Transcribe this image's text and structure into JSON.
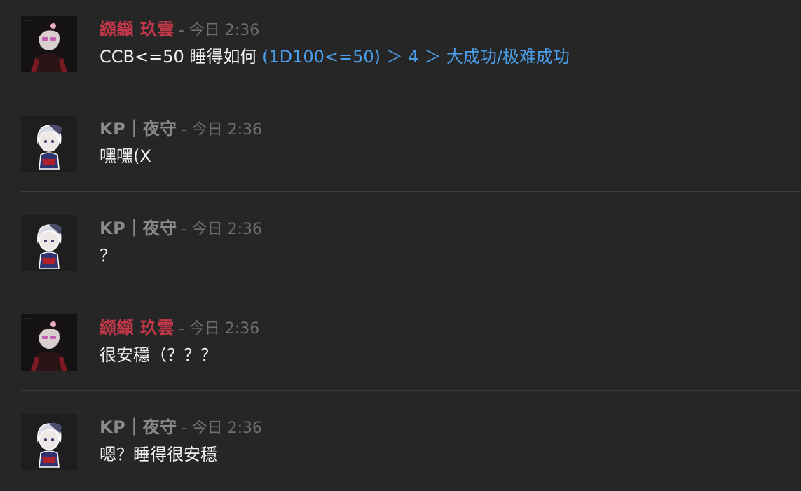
{
  "colors": {
    "background": "#262626",
    "author_red": "#c4384a",
    "author_grey": "#8a8a8a",
    "timestamp": "#6f6f6f",
    "message_text": "#f2f2f2",
    "dice_result": "#4a9eea",
    "divider": "#3c3c3c"
  },
  "messages": [
    {
      "author": "纐纈 玖雲",
      "timestamp": "- 今日 2:36",
      "avatar": "red-haired-character-avatar",
      "text": "CCB<=50 睡得如何 ",
      "roll": "(1D100<=50) ＞ 4 ＞ 大成功/极难成功"
    },
    {
      "author": "KP｜夜守",
      "timestamp": "- 今日 2:36",
      "avatar": "white-haired-chibi-avatar",
      "text": "嘿嘿(X"
    },
    {
      "author": "KP｜夜守",
      "timestamp": "- 今日 2:36",
      "avatar": "white-haired-chibi-avatar",
      "text": "？"
    },
    {
      "author": "纐纈 玖雲",
      "timestamp": "- 今日 2:36",
      "avatar": "red-haired-character-avatar",
      "text": "很安穩（？？？"
    },
    {
      "author": "KP｜夜守",
      "timestamp": "- 今日 2:36",
      "avatar": "white-haired-chibi-avatar",
      "text": "嗯？睡得很安穩"
    }
  ]
}
